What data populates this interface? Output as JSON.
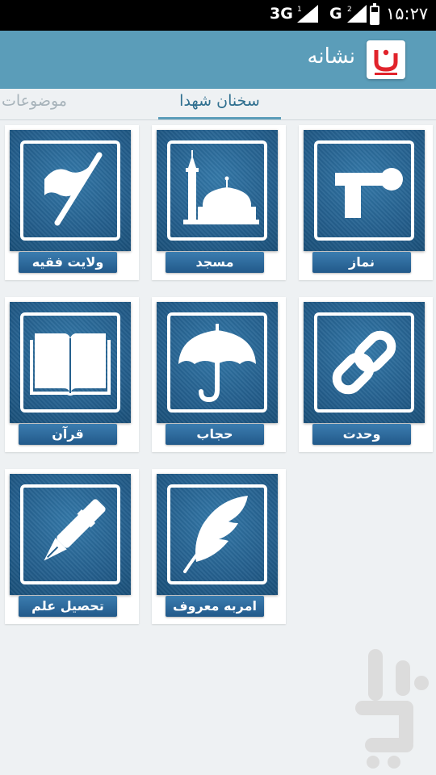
{
  "status_bar": {
    "network1": "3G",
    "network2": "G",
    "time": "۱۵:۲۷",
    "battery_level": 0.7
  },
  "app_bar": {
    "title": "نشانه"
  },
  "tabs": [
    {
      "label": "سخنان شهدا",
      "active": true
    },
    {
      "label": "موضوعات",
      "active": false
    }
  ],
  "grid": {
    "items": [
      {
        "label": "نماز",
        "icon": "prayer-icon"
      },
      {
        "label": "مسجد",
        "icon": "mosque-icon"
      },
      {
        "label": "ولایت فقیه",
        "icon": "flag-icon"
      },
      {
        "label": "وحدت",
        "icon": "chain-link-icon"
      },
      {
        "label": "حجاب",
        "icon": "umbrella-icon"
      },
      {
        "label": "قرآن",
        "icon": "book-icon"
      },
      {
        "label": "امربه معروف",
        "icon": "feather-icon"
      },
      {
        "label": "تحصیل علم",
        "icon": "pen-icon"
      }
    ]
  },
  "colors": {
    "app_bar": "#5b9db9",
    "tile": "#1f5f8d",
    "label_bg": "#2a6a9c",
    "background": "#eef1f3"
  }
}
